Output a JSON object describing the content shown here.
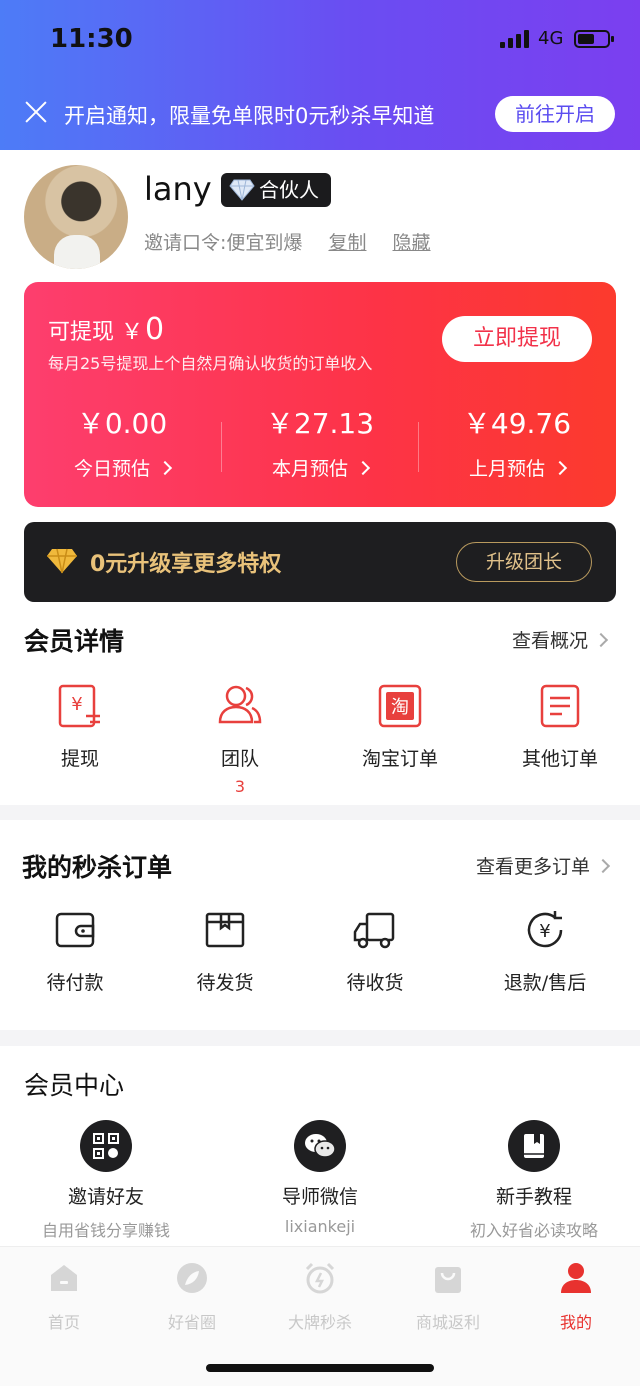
{
  "status_bar": {
    "time": "11:30",
    "network": "4G"
  },
  "notice": {
    "text": "开启通知，限量免单限时0元秒杀早知道",
    "button": "前往开启"
  },
  "profile": {
    "username": "lany",
    "badge": "合伙人",
    "invite_code": "邀请口令:便宜到爆",
    "copy": "复制",
    "hide": "隐藏"
  },
  "withdraw_card": {
    "label": "可提现 ￥",
    "amount": "0",
    "note": "每月25号提现上个自然月确认收货的订单收入",
    "button": "立即提现",
    "estimates": [
      {
        "value": "￥0.00",
        "label": "今日预估"
      },
      {
        "value": "￥27.13",
        "label": "本月预估"
      },
      {
        "value": "￥49.76",
        "label": "上月预估"
      }
    ]
  },
  "upgrade": {
    "text": "0元升级享更多特权",
    "button": "升级团长"
  },
  "member_details": {
    "title": "会员详情",
    "more": "查看概况",
    "items": [
      {
        "label": "提现",
        "icon": "withdraw-icon"
      },
      {
        "label": "团队",
        "icon": "team-icon",
        "count": "3"
      },
      {
        "label": "淘宝订单",
        "icon": "taobao-order-icon"
      },
      {
        "label": "其他订单",
        "icon": "other-order-icon"
      }
    ]
  },
  "flash_orders": {
    "title": "我的秒杀订单",
    "more": "查看更多订单",
    "items": [
      {
        "label": "待付款",
        "icon": "wallet-icon"
      },
      {
        "label": "待发货",
        "icon": "box-icon"
      },
      {
        "label": "待收货",
        "icon": "truck-icon"
      },
      {
        "label": "退款/售后",
        "icon": "refund-icon"
      }
    ]
  },
  "member_center": {
    "title": "会员中心",
    "items": [
      {
        "title": "邀请好友",
        "sub": "自用省钱分享赚钱",
        "icon": "qrcode-icon"
      },
      {
        "title": "导师微信",
        "sub": "lixiankeji",
        "icon": "wechat-icon"
      },
      {
        "title": "新手教程",
        "sub": "初入好省必读攻略",
        "icon": "book-icon"
      }
    ]
  },
  "tabs": [
    {
      "label": "首页",
      "icon": "home-icon"
    },
    {
      "label": "好省圈",
      "icon": "leaf-icon"
    },
    {
      "label": "大牌秒杀",
      "icon": "alarm-icon"
    },
    {
      "label": "商城返利",
      "icon": "bag-icon"
    },
    {
      "label": "我的",
      "icon": "user-icon",
      "active": true
    }
  ],
  "colors": {
    "accent_red": "#fd3346",
    "gold": "#e9c27a",
    "header_start": "#4d7cf7",
    "header_end": "#7b3ff0"
  }
}
